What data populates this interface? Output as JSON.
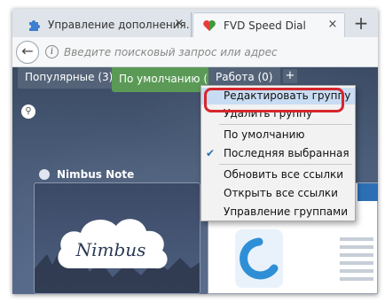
{
  "browser": {
    "tabs": [
      {
        "title": "Управление дополнения…",
        "active": false
      },
      {
        "title": "FVD Speed Dial",
        "active": true
      }
    ],
    "tab_close_glyph": "×",
    "new_tab_glyph": "+",
    "address_bar": {
      "placeholder": "Введите поисковый запрос или адрес",
      "value": ""
    }
  },
  "speed_dial": {
    "groups": [
      {
        "label": "Популярные (3)"
      },
      {
        "label": "По умолчанию (3)",
        "active": true
      },
      {
        "label": "Работа (0)"
      }
    ],
    "add_group_glyph": "+",
    "site_label": "Nimbus Note",
    "logo_text": "Nimbus"
  },
  "context_menu": {
    "items": [
      {
        "label": "Редактировать группу",
        "highlighted": true
      },
      {
        "label": "Удалить группу"
      },
      {
        "label": "По умолчанию"
      },
      {
        "label": "Последняя выбранная",
        "checked": true
      },
      {
        "label": "Обновить все ссылки"
      },
      {
        "label": "Открыть все ссылки"
      },
      {
        "label": "Управление группами"
      }
    ],
    "check_glyph": "✔"
  },
  "colors": {
    "accent_group": "#5a9a56",
    "annotation_ring": "#d7262c",
    "menu_selected": "#c8dcf3"
  }
}
